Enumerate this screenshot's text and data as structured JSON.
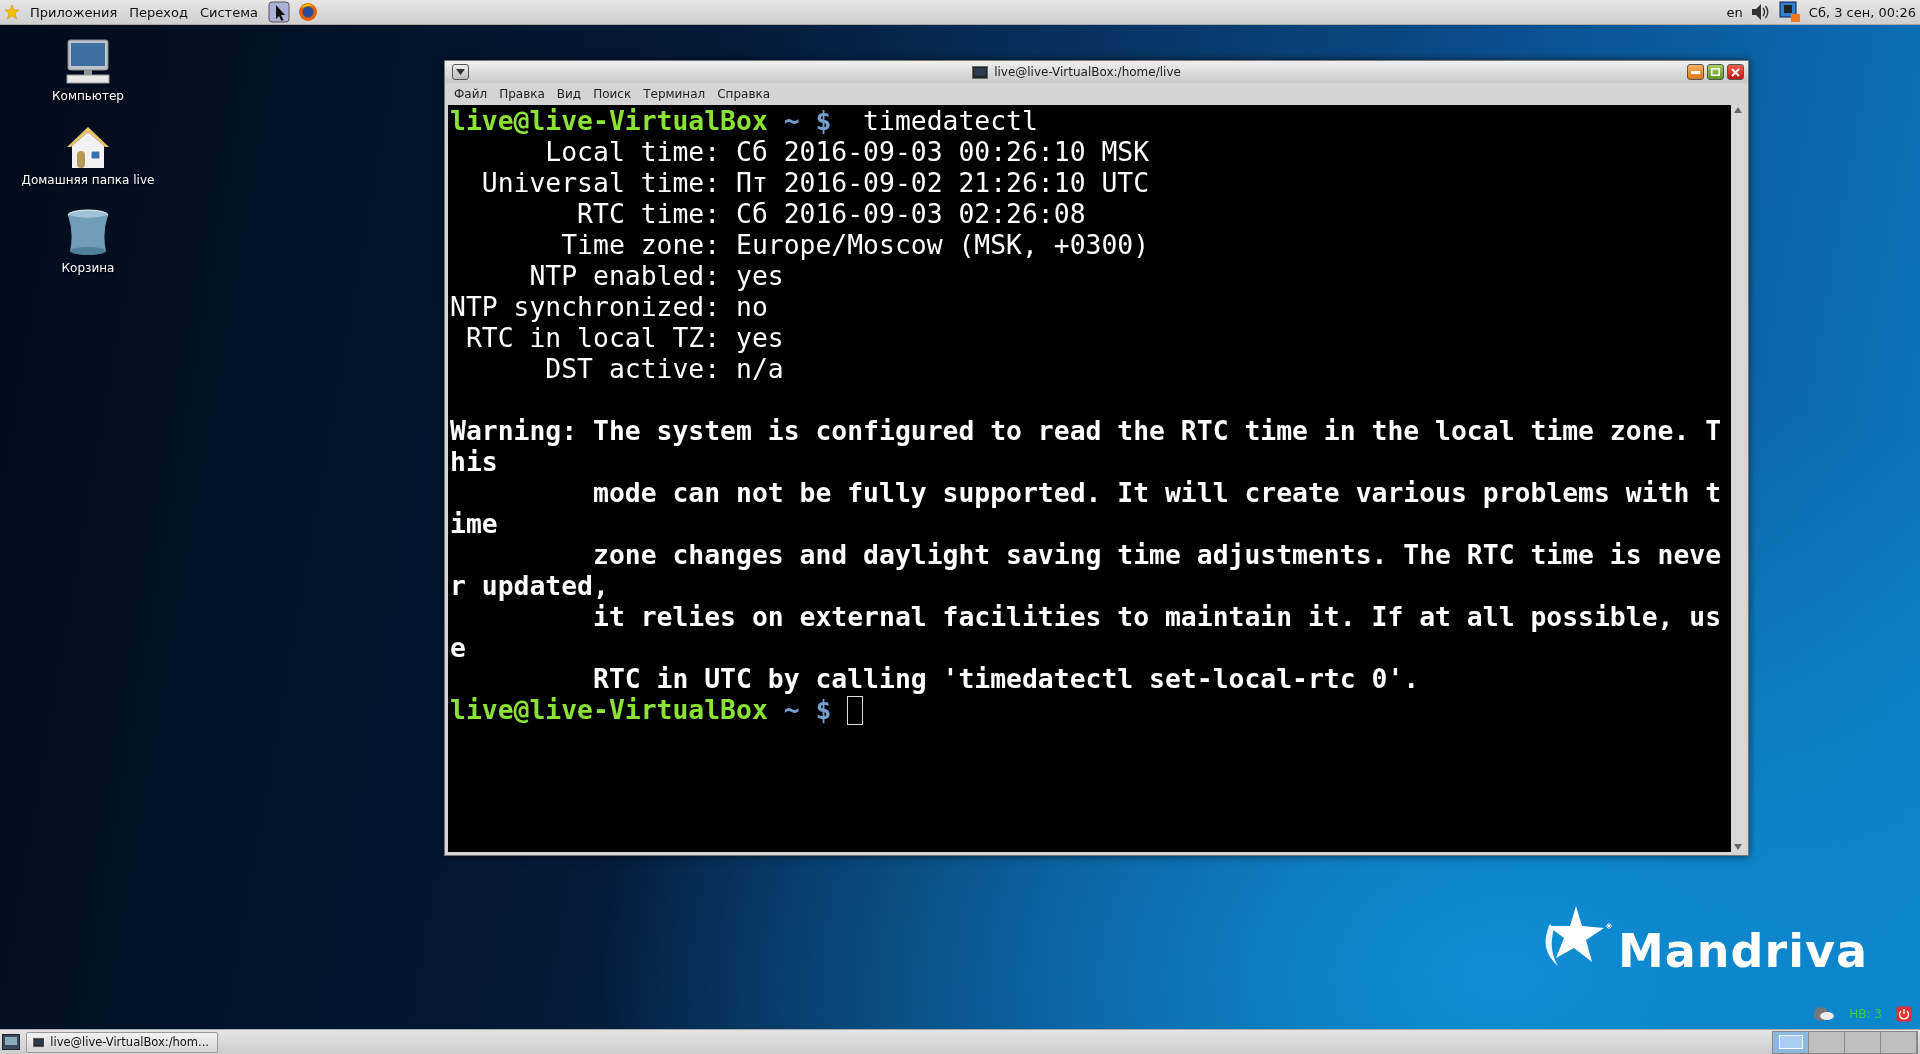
{
  "top_panel": {
    "menus": [
      "Приложения",
      "Переход",
      "Система"
    ],
    "keyboard_layout": "en",
    "clock": "Сб, 3 сен, 00:26"
  },
  "desktop_icons": [
    {
      "kind": "computer",
      "label": "Компьютер"
    },
    {
      "kind": "home",
      "label": "Домашняя папка live"
    },
    {
      "kind": "trash",
      "label": "Корзина"
    }
  ],
  "window": {
    "title": "live@live-VirtualBox:/home/live",
    "menu": [
      "Файл",
      "Правка",
      "Вид",
      "Поиск",
      "Терминал",
      "Справка"
    ],
    "terminal": {
      "lines": [
        {
          "kind": "prompt",
          "user": "live@live-VirtualBox",
          "path": " ~ $ ",
          "command": " timedatectl",
          "cursor": false
        },
        {
          "kind": "output",
          "text": "      Local time: Сб 2016-09-03 00:26:10 MSK",
          "bold": false
        },
        {
          "kind": "output",
          "text": "  Universal time: Пт 2016-09-02 21:26:10 UTC",
          "bold": false
        },
        {
          "kind": "output",
          "text": "        RTC time: Сб 2016-09-03 02:26:08",
          "bold": false
        },
        {
          "kind": "output",
          "text": "       Time zone: Europe/Moscow (MSK, +0300)",
          "bold": false
        },
        {
          "kind": "output",
          "text": "     NTP enabled: yes",
          "bold": false
        },
        {
          "kind": "output",
          "text": "NTP synchronized: no",
          "bold": false
        },
        {
          "kind": "output",
          "text": " RTC in local TZ: yes",
          "bold": false
        },
        {
          "kind": "output",
          "text": "      DST active: n/a",
          "bold": false
        },
        {
          "kind": "blank"
        },
        {
          "kind": "output",
          "text": "Warning: The system is configured to read the RTC time in the local time zone. T",
          "bold": true
        },
        {
          "kind": "output",
          "text": "his",
          "bold": true
        },
        {
          "kind": "output",
          "text": "         mode can not be fully supported. It will create various problems with t",
          "bold": true
        },
        {
          "kind": "output",
          "text": "ime",
          "bold": true
        },
        {
          "kind": "output",
          "text": "         zone changes and daylight saving time adjustments. The RTC time is neve",
          "bold": true
        },
        {
          "kind": "output",
          "text": "r updated,",
          "bold": true
        },
        {
          "kind": "output",
          "text": "         it relies on external facilities to maintain it. If at all possible, us",
          "bold": true
        },
        {
          "kind": "output",
          "text": "e",
          "bold": true
        },
        {
          "kind": "output",
          "text": "         RTC in UTC by calling 'timedatectl set-local-rtc 0'.",
          "bold": true
        },
        {
          "kind": "prompt",
          "user": "live@live-VirtualBox",
          "path": " ~ $ ",
          "cursor": true
        }
      ]
    }
  },
  "wallpaper_logo": "Mandriva",
  "desktop_widgets": {
    "counter": "НВ: 3"
  },
  "taskbar": {
    "tasks": [
      {
        "label": "live@live-VirtualBox:/hom...",
        "selected": false
      }
    ],
    "workspaces": [
      {
        "selected": true
      },
      {
        "selected": false
      },
      {
        "selected": false
      },
      {
        "selected": false
      }
    ]
  }
}
